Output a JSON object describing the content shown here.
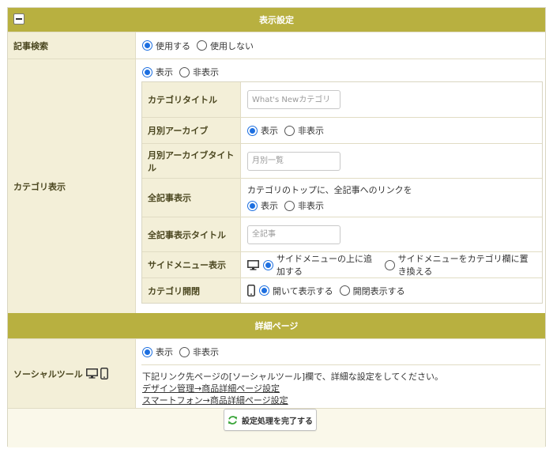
{
  "display_settings": {
    "header": "表示設定",
    "article_search": {
      "label": "記事検索",
      "options": [
        "使用する",
        "使用しない"
      ],
      "selected": 0
    },
    "category_display": {
      "label": "カテゴリ表示",
      "options": [
        "表示",
        "非表示"
      ],
      "selected": 0,
      "category_title": {
        "label": "カテゴリタイトル",
        "placeholder": "What's Newカテゴリ"
      },
      "monthly_archive": {
        "label": "月別アーカイブ",
        "options": [
          "表示",
          "非表示"
        ],
        "selected": 0
      },
      "monthly_archive_title": {
        "label": "月別アーカイブタイトル",
        "placeholder": "月別一覧"
      },
      "all_articles": {
        "label": "全記事表示",
        "note": "カテゴリのトップに、全記事へのリンクを",
        "options": [
          "表示",
          "非表示"
        ],
        "selected": 0
      },
      "all_articles_title": {
        "label": "全記事表示タイトル",
        "placeholder": "全記事"
      },
      "side_menu": {
        "label": "サイドメニュー表示",
        "options": [
          "サイドメニューの上に追加する",
          "サイドメニューをカテゴリ欄に置き換える"
        ],
        "selected": 0
      },
      "category_open": {
        "label": "カテゴリ開閉",
        "options": [
          "開いて表示する",
          "開閉表示する"
        ],
        "selected": 0
      }
    }
  },
  "detail_page": {
    "header": "詳細ページ",
    "social_tools": {
      "label": "ソーシャルツール",
      "options": [
        "表示",
        "非表示"
      ],
      "selected": 0,
      "note": "下記リンク先ページの[ソーシャルツール]欄で、詳細な設定をしてください。",
      "links": [
        "デザイン管理→商品詳細ページ設定",
        "スマートフォン→商品詳細ページ設定"
      ]
    }
  },
  "submit_label": "設定処理を完了する",
  "colors": {
    "header_bg": "#b8b040",
    "label_bg": "#f3efd8",
    "radio_on": "#1d6fe0",
    "refresh_icon": "#3aa53a"
  }
}
